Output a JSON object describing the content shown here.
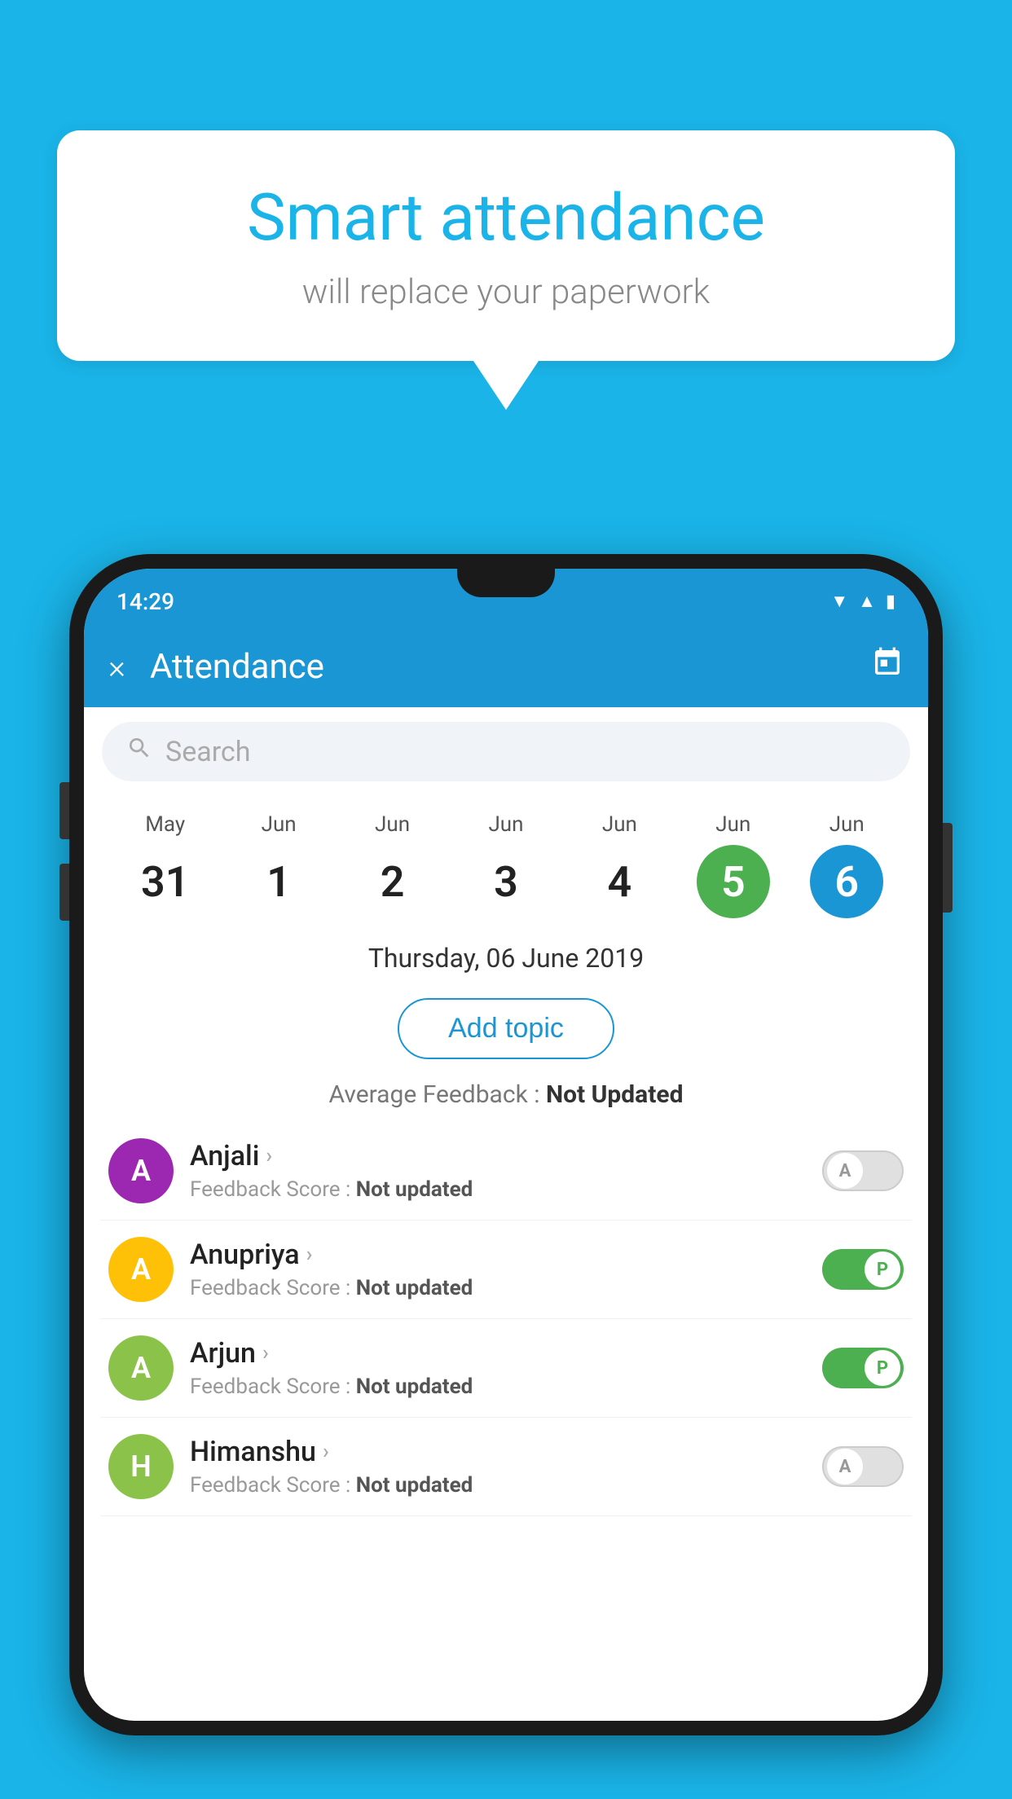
{
  "background_color": "#1ab4e8",
  "speech_bubble": {
    "title": "Smart attendance",
    "subtitle": "will replace your paperwork"
  },
  "status_bar": {
    "time": "14:29"
  },
  "app_bar": {
    "title": "Attendance",
    "close_label": "×",
    "calendar_icon": "📅"
  },
  "search": {
    "placeholder": "Search"
  },
  "calendar": {
    "days": [
      {
        "month": "May",
        "date": "31",
        "style": "normal"
      },
      {
        "month": "Jun",
        "date": "1",
        "style": "normal"
      },
      {
        "month": "Jun",
        "date": "2",
        "style": "normal"
      },
      {
        "month": "Jun",
        "date": "3",
        "style": "normal"
      },
      {
        "month": "Jun",
        "date": "4",
        "style": "normal"
      },
      {
        "month": "Jun",
        "date": "5",
        "style": "active-green"
      },
      {
        "month": "Jun",
        "date": "6",
        "style": "active-blue"
      }
    ]
  },
  "selected_date": "Thursday, 06 June 2019",
  "add_topic_label": "Add topic",
  "avg_feedback_label": "Average Feedback : ",
  "avg_feedback_value": "Not Updated",
  "students": [
    {
      "name": "Anjali",
      "avatar_letter": "A",
      "avatar_color": "#9c27b0",
      "feedback_label": "Feedback Score : ",
      "feedback_value": "Not updated",
      "attendance": "absent",
      "toggle_letter": "A"
    },
    {
      "name": "Anupriya",
      "avatar_letter": "A",
      "avatar_color": "#ffc107",
      "feedback_label": "Feedback Score : ",
      "feedback_value": "Not updated",
      "attendance": "present",
      "toggle_letter": "P"
    },
    {
      "name": "Arjun",
      "avatar_letter": "A",
      "avatar_color": "#8bc34a",
      "feedback_label": "Feedback Score : ",
      "feedback_value": "Not updated",
      "attendance": "present",
      "toggle_letter": "P"
    },
    {
      "name": "Himanshu",
      "avatar_letter": "H",
      "avatar_color": "#8bc34a",
      "feedback_label": "Feedback Score : ",
      "feedback_value": "Not updated",
      "attendance": "absent",
      "toggle_letter": "A"
    }
  ]
}
